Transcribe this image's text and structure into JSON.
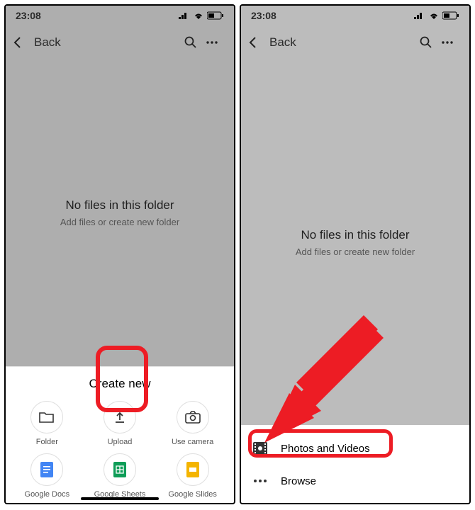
{
  "status": {
    "time": "23:08"
  },
  "header": {
    "back": "Back"
  },
  "empty": {
    "title": "No files in this folder",
    "subtitle": "Add files or create new folder"
  },
  "sheet": {
    "title": "Create new",
    "items": [
      {
        "label": "Folder"
      },
      {
        "label": "Upload"
      },
      {
        "label": "Use camera"
      },
      {
        "label": "Google Docs"
      },
      {
        "label": "Google Sheets"
      },
      {
        "label": "Google Slides"
      }
    ]
  },
  "upload": {
    "items": [
      {
        "label": "Photos and Videos"
      },
      {
        "label": "Browse"
      }
    ]
  }
}
